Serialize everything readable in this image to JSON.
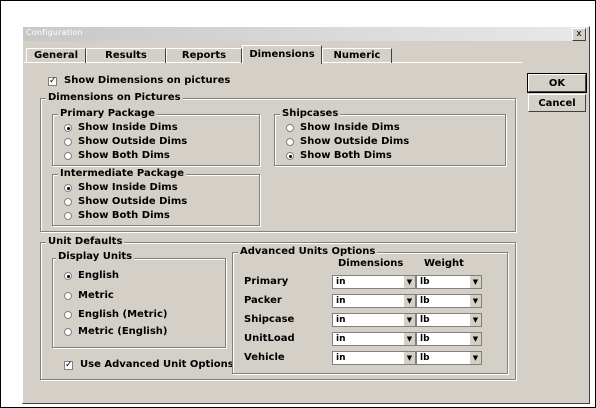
{
  "window": {
    "title": "Configuration",
    "close_glyph": "x"
  },
  "tabs": [
    {
      "label": "General"
    },
    {
      "label": "Results"
    },
    {
      "label": "Reports"
    },
    {
      "label": "Dimensions",
      "active": true
    },
    {
      "label": "Numeric"
    }
  ],
  "buttons": {
    "ok": "OK",
    "cancel": "Cancel"
  },
  "show_dims": {
    "label": "Show Dimensions on pictures",
    "checked": true
  },
  "dims_on_pictures": {
    "legend": "Dimensions on Pictures",
    "primary": {
      "legend": "Primary Package",
      "options": [
        "Show Inside Dims",
        "Show Outside Dims",
        "Show Both Dims"
      ],
      "selected": 0
    },
    "intermediate": {
      "legend": "Intermediate Package",
      "options": [
        "Show Inside Dims",
        "Show Outside Dims",
        "Show Both Dims"
      ],
      "selected": 0
    },
    "shipcases": {
      "legend": "Shipcases",
      "options": [
        "Show Inside Dims",
        "Show Outside Dims",
        "Show Both Dims"
      ],
      "selected": 2
    }
  },
  "unit_defaults": {
    "legend": "Unit Defaults",
    "display_units": {
      "legend": "Display Units",
      "options": [
        "English",
        "Metric",
        "English (Metric)",
        "Metric (English)"
      ],
      "selected": 0
    },
    "use_advanced": {
      "label": "Use Advanced Unit Options",
      "checked": true
    }
  },
  "advanced_units": {
    "legend": "Advanced Units Options",
    "col_dimensions": "Dimensions",
    "col_weight": "Weight",
    "rows": [
      {
        "label": "Primary",
        "dim": "in",
        "weight": "lb"
      },
      {
        "label": "Packer",
        "dim": "in",
        "weight": "lb"
      },
      {
        "label": "Shipcase",
        "dim": "in",
        "weight": "lb"
      },
      {
        "label": "UnitLoad",
        "dim": "in",
        "weight": "lb"
      },
      {
        "label": "Vehicle",
        "dim": "in",
        "weight": "lb"
      }
    ]
  },
  "colors": {
    "dialog_bg": "#d4d0c8"
  }
}
